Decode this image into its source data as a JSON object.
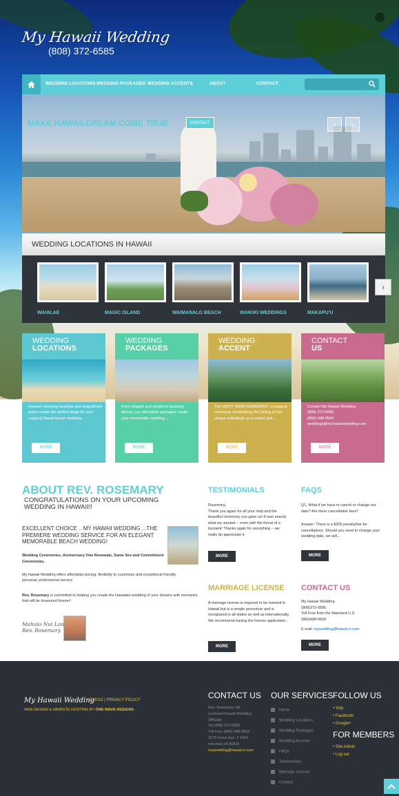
{
  "brand": {
    "title": "My Hawaii Wedding",
    "phone": "(808) 372-6585"
  },
  "nav": {
    "items": [
      "WEDDING LOCATIONS",
      "WEDDING PACKAGES",
      "WEDDING ACCENTS",
      "ABOUT",
      "CONTACT"
    ]
  },
  "slider": {
    "caption": "MAKE HAWAII DREAM COME TRUE",
    "button": "CONTACT",
    "prev": "‹",
    "next": "›"
  },
  "locations": {
    "heading": "WEDDING LOCATIONS IN HAWAII",
    "items": [
      "WAIALAE",
      "MAGIC ISLAND",
      "WAIMANALO BEACH",
      "WAIKIKI WEDDINGS",
      "MAKAPU'U"
    ],
    "next": "›"
  },
  "cards": [
    {
      "line1": "WEDDING",
      "line2": "LOCATIONS",
      "text": "Hawaii's amazing beaches and magnificent parks create the perfect stage for your magical Hawaii beach wedding...",
      "button": "MORE",
      "color": "#5ec8d2"
    },
    {
      "line1": "WEDDING",
      "line2": "PACKAGES",
      "text": "From elegant and simple to stunning deluxe, our affordable packages create your memorable wedding ....",
      "button": "MORE",
      "color": "#57cfa7"
    },
    {
      "line1": "WEDDING",
      "line2": "ACCENT",
      "text": "The UNITY SAND CEREMONY: a magical ceremony symbolizing the joining of two unique individuals as a united and ...",
      "button": "MORE",
      "color": "#cdb14f"
    },
    {
      "line1": "CONTACT",
      "line2": "US",
      "text": "Contact My Hawaii Wedding\n(808) 372-6585\n(866) 498-0504\nweddings@myhawaiiwedding.com",
      "button": "MORE",
      "color": "#c96b8f"
    }
  ],
  "about": {
    "title": "ABOUT REV. ROSEMARY",
    "subtitle": "CONGRATULATIONS ON YOUR UPCOMING WEDDING IN HAWAII!!",
    "lead": "EXCELLENT CHOICE .. MY HAWAII WEDDING ...THE PREMIERE WEDDING SERVICE FOR AN ELEGANT MEMORABLE BEACH WEDDING!",
    "bold": "Wedding Ceremonies, Anniversary Vow Renewals, Same Sex and Commitment Ceremonies.",
    "p1": "My Hawaii Wedding offers affordable pricing, flexibility to customize and exceptional friendly, personal, professional service.",
    "p2_name": "Rev. Rosemary",
    "p2": " is committed to helping you create the Hawaiian wedding of your dreams with memories that will be treasured forever!",
    "signature": "Mahalo Nui Loa\nRev. Rosemary"
  },
  "testimonials": {
    "title": "TESTIMONIALS",
    "text": "Rosemary,\nThank you again for all your help and the beautiful ceremony you gave us! It was exactly what we wanted -- even with the threat of a tsunami! Thanks again for everything -- we really do appreciate it.",
    "button": "MORE"
  },
  "faqs": {
    "title": "FAQS",
    "q": "Q1. What if we have to cancel or change our date? Are there cancellation fees?",
    "a": "Answer: There is a $200 penalty/fee for cancellations. Should you need to change your wedding date, we will...",
    "button": "MORE"
  },
  "license": {
    "title": "MARRIAGE LICENSE",
    "text": "A marriage license is required to be married in Hawaii but is a simple procedure and is recognized in all states as well as internationally. We recommend having the license application...",
    "button": "MORE"
  },
  "contact": {
    "title": "CONTACT US",
    "text": "My Hawaii Wedding\n(808)372-6585\nToll Free from the Mainland U.S\n(866)498-0504",
    "email_label": "E-mail: ",
    "email": "mywedding@hawaii.rr.com",
    "button": "MORE"
  },
  "footer": {
    "logo": "My Hawaii Wedding",
    "copy": "© 2015 | PRIVACY POLICY",
    "credit_prefix": "WEB DESIGN & WEBSITE HOSTING BY ",
    "credit_link": "ONE WAVE DESIGNS",
    "contact_title": "CONTACT US",
    "contact_text": "Rev. Rosemary Hill\nLicensed Hawaii Wedding\nOfficiate\nTel (808) 372-6585\nToll Free (866) 498-0504\n2575 Kuhio Ave. # 1804\nHonolulu HI 96815",
    "contact_email": "mywedding@hawaii.rr.com",
    "services_title": "OUR SERVICES",
    "services": [
      "Home",
      "Wedding Locations",
      "Wedding Packages",
      "Wedding Accents",
      "FAQs",
      "Testimonials",
      "Marriage License",
      "Contact"
    ],
    "follow_title": "FOLLOW US",
    "follow": [
      "Yelp",
      "Facebook",
      "Google+"
    ],
    "members_title": "FOR MEMBERS",
    "members": [
      "Site Admin",
      "Log out"
    ]
  }
}
